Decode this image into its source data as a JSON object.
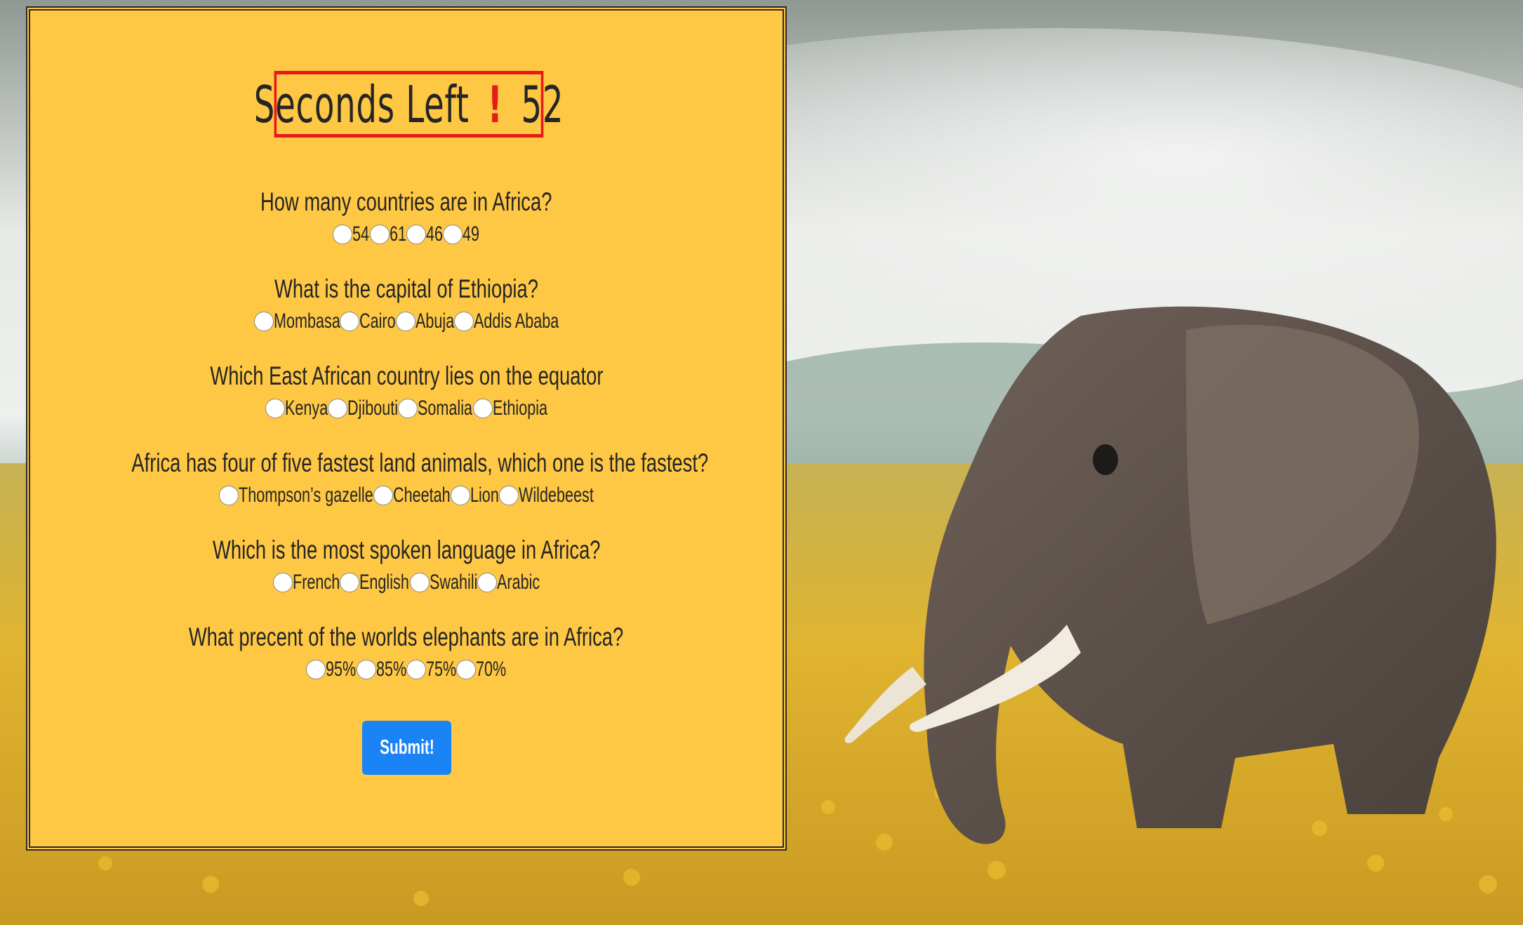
{
  "timer": {
    "label": "Seconds Left",
    "icon": "exclamation-icon",
    "symbol": "!",
    "seconds": "52",
    "border_color": "#e8191b"
  },
  "quiz": {
    "panel_color": "#ffc844",
    "questions": [
      {
        "text": "How many countries are in Africa?",
        "options": [
          "54",
          "61",
          "46",
          "49"
        ]
      },
      {
        "text": "What is the capital of Ethiopia?",
        "options": [
          "Mombasa",
          "Cairo",
          "Abuja",
          "Addis Ababa"
        ]
      },
      {
        "text": "Which East African country lies on the equator",
        "options": [
          "Kenya",
          "Djibouti",
          "Somalia",
          "Ethiopia"
        ]
      },
      {
        "text": "Africa has four of five fastest land animals, which one is the fastest?",
        "options": [
          "Thompson’s gazelle",
          "Cheetah",
          "Lion",
          "Wildebeest"
        ]
      },
      {
        "text": "Which is the most spoken language in Africa?",
        "options": [
          "French",
          "English",
          "Swahili",
          "Arabic"
        ]
      },
      {
        "text": "What precent of the worlds elephants are in Africa?",
        "options": [
          "95%",
          "85%",
          "75%",
          "70%"
        ]
      }
    ],
    "submit_label": "Submit!",
    "submit_color": "#1a83f5"
  },
  "background": {
    "subject": "elephant-in-yellow-flower-field-photo"
  }
}
